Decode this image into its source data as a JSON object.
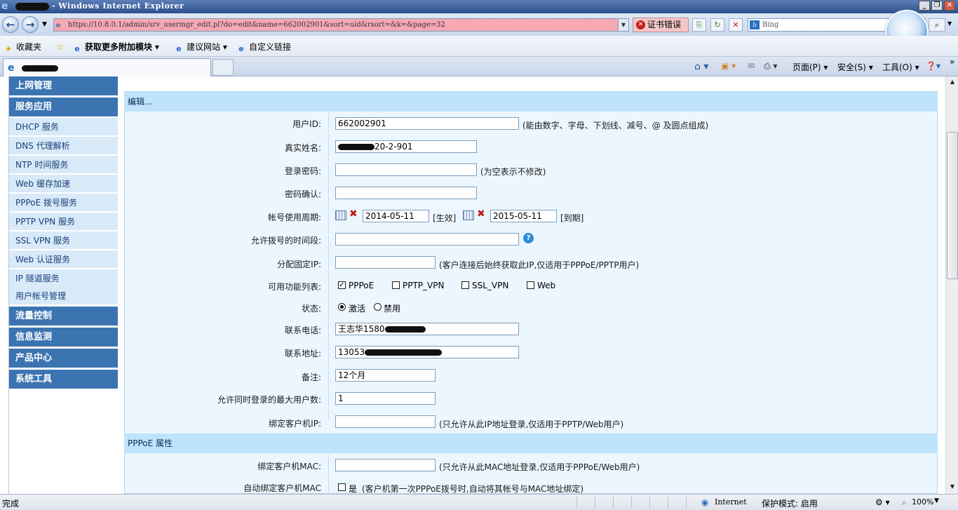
{
  "window": {
    "title": "- Windows Internet Explorer",
    "controls": [
      "_",
      "❐",
      "✕"
    ]
  },
  "browser": {
    "url": "https://10.8.0.1/admin/srv_usermgr_edit.pl?do=edit&name=662002901&sort=uid&rsort=&k=&page=32",
    "cert_error": "证书错误",
    "search_placeholder": "Bing",
    "favorites_label": "收藏夹",
    "fav_items": [
      "获取更多附加模块",
      "建议网站",
      "自定义链接"
    ],
    "command_items": [
      "页面(P)",
      "安全(S)",
      "工具(O)"
    ]
  },
  "sidebar": {
    "groups_top": [
      "上网管理",
      "服务应用"
    ],
    "items": [
      "DHCP 服务",
      "DNS 代理解析",
      "NTP 时间服务",
      "Web 缓存加速",
      "PPPoE 拨号服务",
      "PPTP VPN 服务",
      "SSL VPN 服务",
      "Web 认证服务",
      "IP 隧道服务",
      "用户帐号管理"
    ],
    "groups_bottom": [
      "流量控制",
      "信息监测",
      "产品中心",
      "系统工具"
    ]
  },
  "form": {
    "section_edit": "编辑...",
    "section_pppoe": "PPPoE 属性",
    "user_id": {
      "label": "用户ID:",
      "value": "662002901",
      "hint": "(能由数字、字母、下划线、减号、@ 及圆点组成)"
    },
    "real_name": {
      "label": "真实姓名:",
      "value": "20-2-901"
    },
    "password": {
      "label": "登录密码:",
      "value": "",
      "hint": "(为空表示不修改)"
    },
    "password_confirm": {
      "label": "密码确认:",
      "value": ""
    },
    "period": {
      "label": "帐号使用周期:",
      "start": "2014-05-11",
      "start_tag": "[生效]",
      "end": "2015-05-11",
      "end_tag": "[到期]"
    },
    "dial_time": {
      "label": "允许拨号的时间段:",
      "value": ""
    },
    "fixed_ip": {
      "label": "分配固定IP:",
      "value": "",
      "hint": "(客户连接后始终获取此IP,仅适用于PPPoE/PPTP用户)"
    },
    "features": {
      "label": "可用功能列表:",
      "options": [
        "PPPoE",
        "PPTP_VPN",
        "SSL_VPN",
        "Web"
      ],
      "checked": [
        true,
        false,
        false,
        false
      ]
    },
    "status": {
      "label": "状态:",
      "options": [
        "激活",
        "禁用"
      ],
      "selected": 0
    },
    "phone": {
      "label": "联系电话:",
      "value": "王志华1580"
    },
    "address": {
      "label": "联系地址:",
      "value": "13053"
    },
    "note": {
      "label": "备注:",
      "value": "12个月"
    },
    "max_users": {
      "label": "允许同时登录的最大用户数:",
      "value": "1"
    },
    "bind_ip": {
      "label": "绑定客户机IP:",
      "value": "",
      "hint": "(只允许从此IP地址登录,仅适用于PPTP/Web用户)"
    },
    "bind_mac": {
      "label": "绑定客户机MAC:",
      "value": "",
      "hint": "(只允许从此MAC地址登录,仅适用于PPPoE/Web用户)"
    },
    "auto_bind_mac": {
      "label": "自动绑定客户机MAC",
      "option": "是",
      "hint": "(客户机第一次PPPoE拨号时,自动将其帐号与MAC地址绑定)"
    }
  },
  "statusbar": {
    "left": "完成",
    "zone": "Internet",
    "protected_mode": "保护模式: 启用",
    "zoom": "100%"
  }
}
